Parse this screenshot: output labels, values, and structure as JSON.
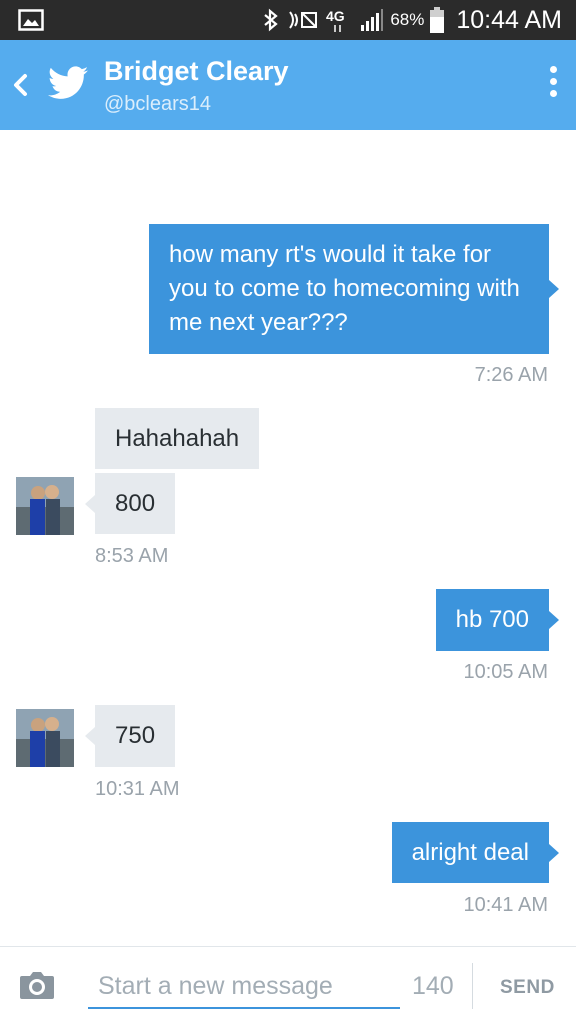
{
  "status_bar": {
    "battery_percent": "68%",
    "time": "10:44 AM",
    "network": "4G",
    "icons": [
      "gallery-icon",
      "bluetooth-icon",
      "nfc-icon",
      "signal-icon",
      "battery-icon"
    ]
  },
  "header": {
    "name": "Bridget Cleary",
    "handle": "@bclears14",
    "icons": [
      "back-icon",
      "twitter-bird-icon",
      "overflow-menu-icon"
    ]
  },
  "messages": [
    {
      "direction": "sent",
      "text": "how many rt's would it take for you to come to homecoming with me next year???",
      "time": "7:26 AM"
    },
    {
      "direction": "received",
      "text": "Hahahahah"
    },
    {
      "direction": "received",
      "text": "800",
      "time": "8:53 AM"
    },
    {
      "direction": "sent",
      "text": "hb 700",
      "time": "10:05 AM"
    },
    {
      "direction": "received",
      "text": "750",
      "time": "10:31 AM"
    },
    {
      "direction": "sent",
      "text": "alright deal",
      "time": "10:41 AM"
    }
  ],
  "composer": {
    "placeholder": "Start a new message",
    "value": "",
    "char_count": "140",
    "send_label": "SEND"
  },
  "colors": {
    "header": "#55acee",
    "sent_bubble": "#3c94dc",
    "received_bubble": "#e6eaee",
    "status_bar": "#2b2b2b"
  }
}
